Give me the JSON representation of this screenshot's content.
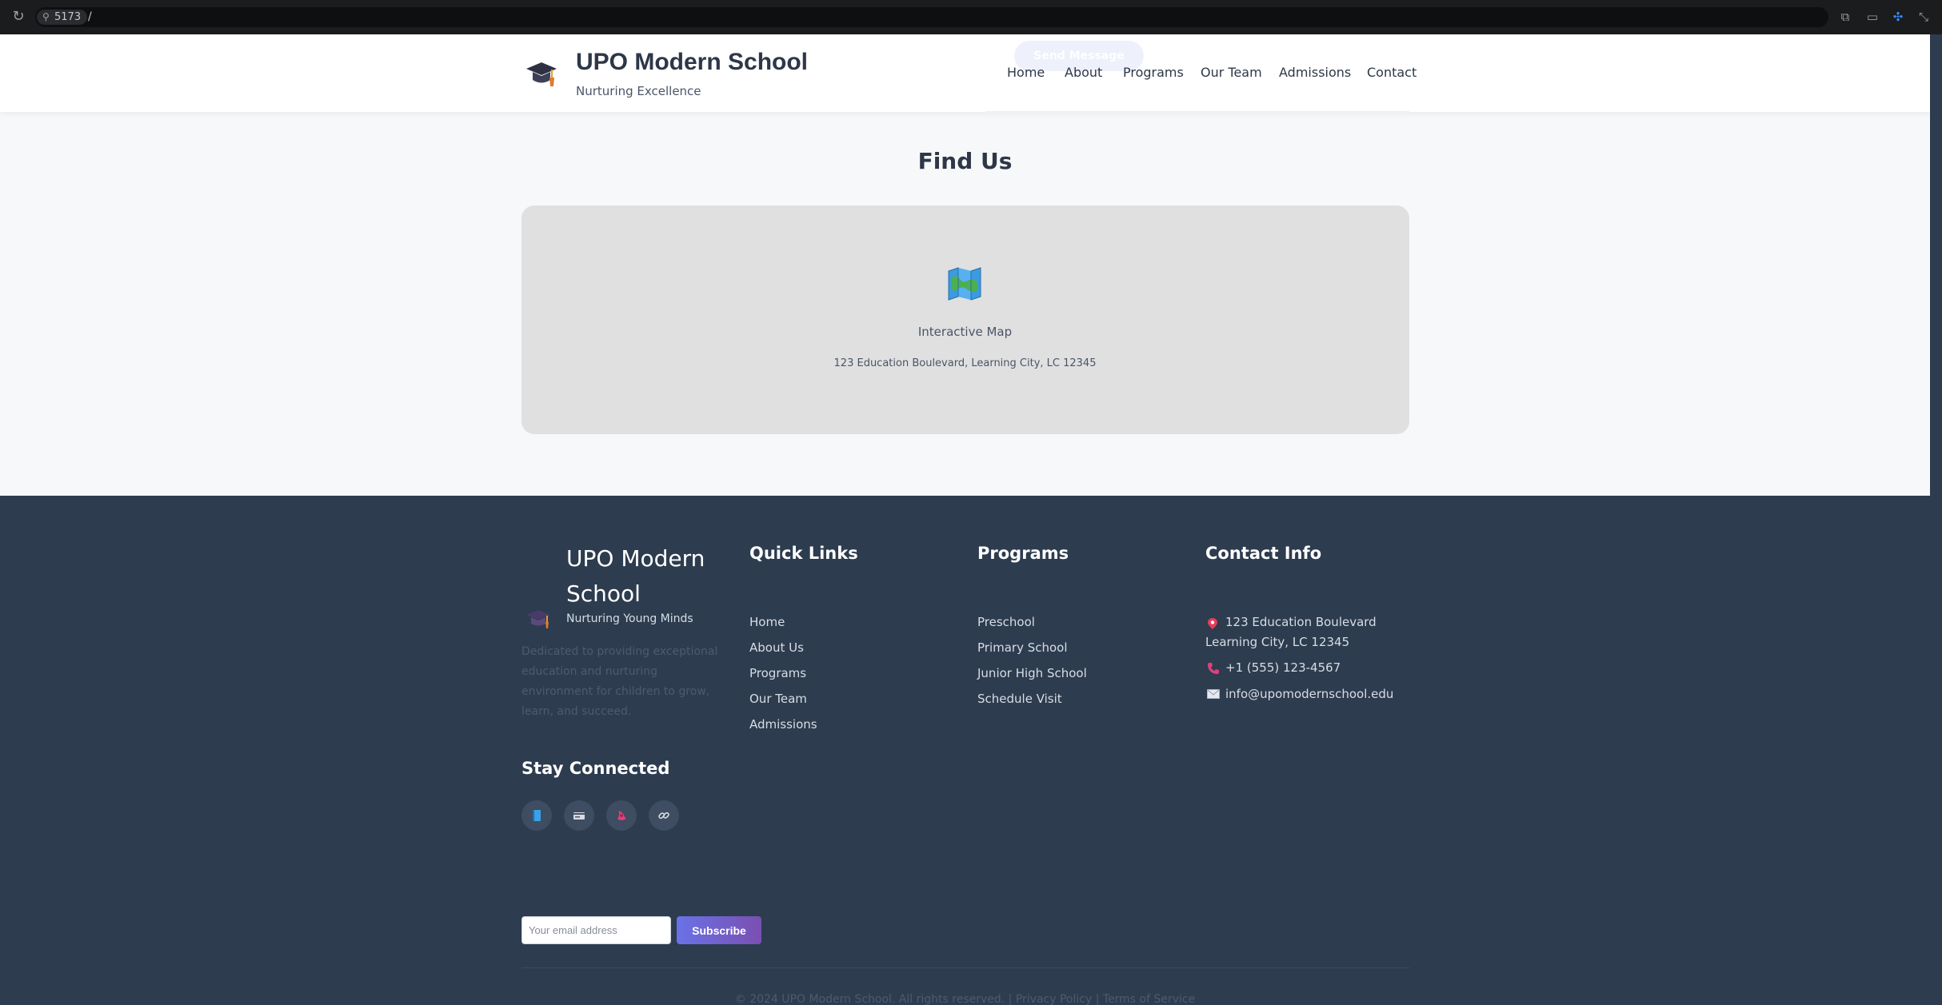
{
  "browser": {
    "port": "5173",
    "path": "/",
    "reload_icon": "reload-icon",
    "toolbar_icons": [
      "open-external-icon",
      "devices-icon",
      "inspect-icon",
      "exit-fullscreen-icon"
    ]
  },
  "header": {
    "logo_icon": "graduation-cap-icon",
    "title": "UPO Modern School",
    "tagline": "Nurturing Excellence",
    "ghost_button": "Send Message",
    "nav": [
      "Home",
      "About",
      "Programs",
      "Our Team",
      "Admissions",
      "Contact"
    ]
  },
  "map_section": {
    "title": "Find Us",
    "map_icon": "map-icon",
    "label": "Interactive Map",
    "address": "123 Education Boulevard, Learning City, LC 12345"
  },
  "footer": {
    "brand_title": "UPO Modern School",
    "brand_tagline": "Nurturing Young Minds",
    "description": "Dedicated to providing exceptional education and nurturing environment for children to grow, learn, and succeed.",
    "quick_links": {
      "title": "Quick Links",
      "items": [
        "Home",
        "About Us",
        "Programs",
        "Our Team",
        "Admissions"
      ]
    },
    "programs": {
      "title": "Programs",
      "items": [
        "Preschool",
        "Primary School",
        "Junior High School",
        "Schedule Visit"
      ]
    },
    "contact": {
      "title": "Contact Info",
      "address_line1": "123 Education Boulevard",
      "address_line2": "Learning City, LC 12345",
      "phone": "+1 (555) 123-4567",
      "email": "info@upomodernschool.edu",
      "icons": [
        "pin-icon",
        "phone-icon",
        "envelope-icon"
      ]
    },
    "stay_connected": {
      "title": "Stay Connected",
      "socials": [
        "facebook-book-icon",
        "id-card-icon",
        "camera-icon",
        "link-icon"
      ]
    },
    "newsletter": {
      "placeholder": "Your email address",
      "button": "Subscribe"
    },
    "copyright": "© 2024 UPO Modern School. All rights reserved. | Privacy Policy | Terms of Service"
  },
  "colors": {
    "header_bg": "#ffffff",
    "page_bg": "#f7f8fa",
    "footer_bg": "#2d3c4f",
    "map_card_bg": "#e0e0e0",
    "accent": "#6a72e6",
    "text_dark": "#2d3748"
  }
}
